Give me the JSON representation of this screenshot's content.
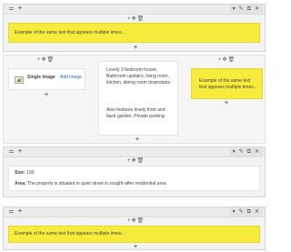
{
  "icons": {
    "drag": "drag-handle-icon",
    "add": "+",
    "move": "✥",
    "delete": "🗑",
    "edit": "✎",
    "duplicate": "⧉",
    "remove": "✕",
    "image": "image-icon"
  },
  "colors": {
    "highlight": "#f7ec3c",
    "row_bg": "#f3f3f3",
    "link": "#2a6db5"
  },
  "rows": {
    "row1": {
      "text": "Example of the same text that appears multiple times..."
    },
    "row2": {
      "image_block": {
        "title": "Single Image",
        "link": "Add image"
      },
      "text_block": {
        "para1": "Lovely 3 bedroom house. Bathroom upstairs, living room, kitchen, dining room downstairs.",
        "para2": "Also features lovely front and back garden. Private parking."
      },
      "yellow_block": {
        "text": "Example of the same text that appears multiple times..."
      }
    },
    "row3": {
      "size_label": "Size:",
      "size_value": "130",
      "area_label": "Area:",
      "area_value": "The property is situated in quiet street in sought-after residential area"
    },
    "row4": {
      "text": "Example of the same text that appears multiple times..."
    }
  }
}
